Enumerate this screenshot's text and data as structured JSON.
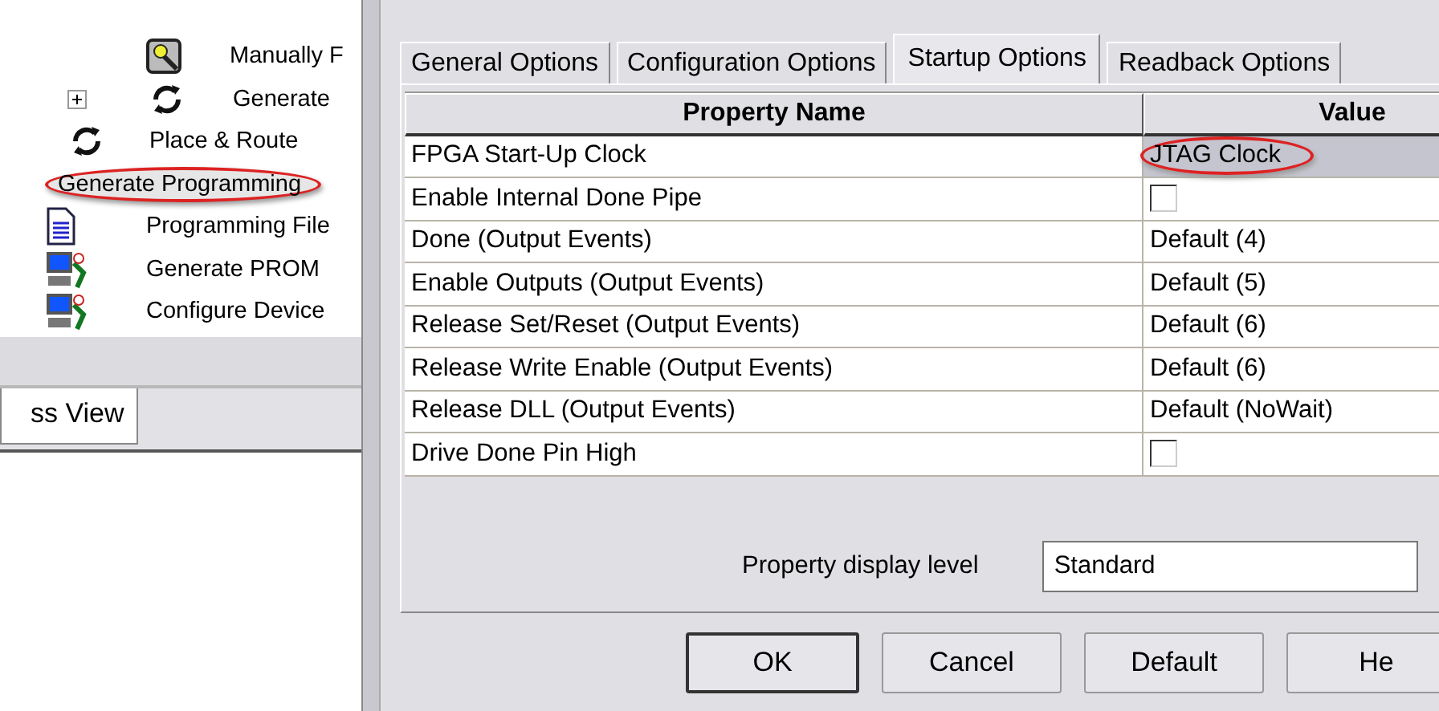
{
  "tree": [
    {
      "label": "Manually F",
      "selected": false,
      "circled": false
    },
    {
      "label": "Generate",
      "expanded": false,
      "selected": false,
      "circled": false
    },
    {
      "label": "Place & Route",
      "selected": false,
      "circled": false
    },
    {
      "label": "Generate Programming",
      "selected": true,
      "circled": true,
      "children": [
        {
          "label": "Programming File",
          "selected": false
        },
        {
          "label": "Generate PROM",
          "selected": false
        },
        {
          "label": "Configure Device",
          "selected": false
        }
      ]
    }
  ],
  "bottom_tab": {
    "label": "ss View"
  },
  "tabs": [
    {
      "label": "General Options",
      "selected": false
    },
    {
      "label": "Configuration Options",
      "selected": false
    },
    {
      "label": "Startup Options",
      "selected": true
    },
    {
      "label": "Readback Options",
      "selected": false
    }
  ],
  "table": {
    "columns": [
      "Property Name",
      "Value"
    ],
    "rows": [
      {
        "name": "FPGA Start-Up Clock",
        "kind": "text",
        "value": "JTAG Clock",
        "selected": true,
        "circled": true
      },
      {
        "name": "Enable Internal Done Pipe",
        "kind": "checkbox",
        "checked": false,
        "selected": false,
        "circled": false
      },
      {
        "name": "Done (Output Events)",
        "kind": "text",
        "value": "Default (4)",
        "selected": false,
        "circled": false
      },
      {
        "name": "Enable Outputs (Output Events)",
        "kind": "text",
        "value": "Default (5)",
        "selected": false,
        "circled": false
      },
      {
        "name": "Release Set/Reset (Output Events)",
        "kind": "text",
        "value": "Default (6)",
        "selected": false,
        "circled": false
      },
      {
        "name": "Release Write Enable (Output Events)",
        "kind": "text",
        "value": "Default (6)",
        "selected": false,
        "circled": false
      },
      {
        "name": "Release DLL (Output Events)",
        "kind": "text",
        "value": "Default (NoWait)",
        "selected": false,
        "circled": false
      },
      {
        "name": "Drive Done Pin High",
        "kind": "checkbox",
        "checked": false,
        "selected": false,
        "circled": false
      }
    ]
  },
  "display_level": {
    "label": "Property display level",
    "value": "Standard"
  },
  "buttons": [
    {
      "label": "OK",
      "default": true
    },
    {
      "label": "Cancel",
      "default": false
    },
    {
      "label": "Default",
      "default": false
    },
    {
      "label": "He",
      "default": false
    }
  ]
}
